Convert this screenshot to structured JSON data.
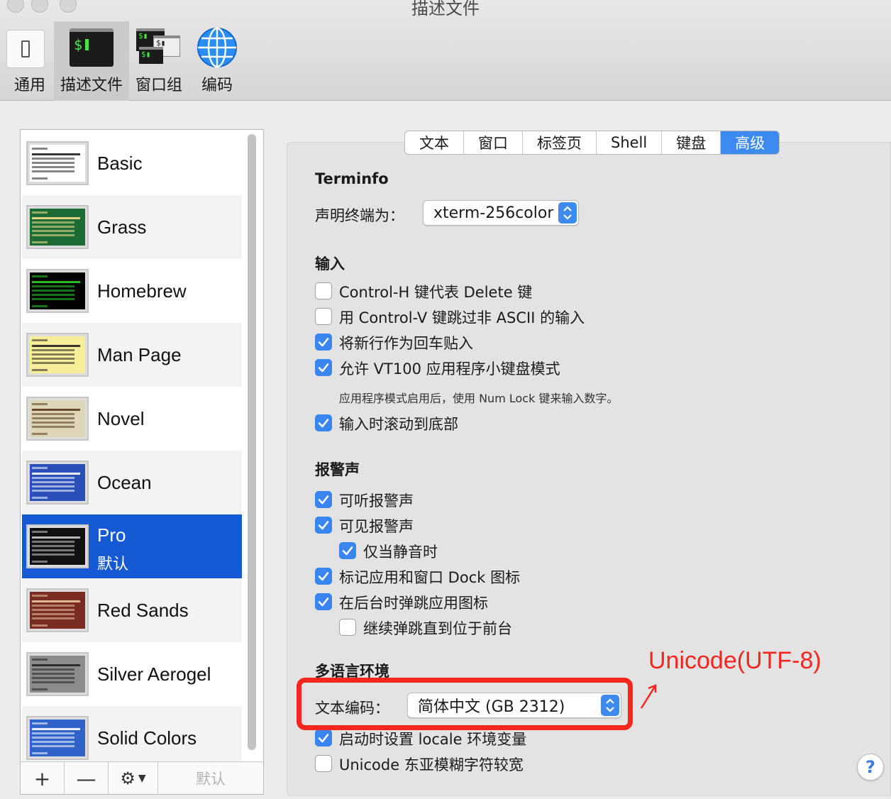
{
  "window": {
    "title": "描述文件"
  },
  "toolbar": {
    "items": [
      {
        "label": "通用"
      },
      {
        "label": "描述文件",
        "selected": true
      },
      {
        "label": "窗口组"
      },
      {
        "label": "编码"
      }
    ],
    "terminal_prompt": "$",
    "terminal_prompt_small": "$"
  },
  "profiles": {
    "items": [
      {
        "name": "Basic",
        "bg": "#ffffff",
        "fg": "#222222"
      },
      {
        "name": "Grass",
        "bg": "#1d6b34",
        "fg": "#f5e08a"
      },
      {
        "name": "Homebrew",
        "bg": "#000000",
        "fg": "#28d12a"
      },
      {
        "name": "Man Page",
        "bg": "#f8ee9a",
        "fg": "#222222"
      },
      {
        "name": "Novel",
        "bg": "#ddd6b9",
        "fg": "#5a3b21"
      },
      {
        "name": "Ocean",
        "bg": "#2a4fb8",
        "fg": "#ffffff"
      },
      {
        "name": "Pro",
        "sub": "默认",
        "bg": "#111111",
        "fg": "#cccccc",
        "selected": true
      },
      {
        "name": "Red Sands",
        "bg": "#7a2c22",
        "fg": "#e8c9a0"
      },
      {
        "name": "Silver Aerogel",
        "bg": "#8c8c8c",
        "fg": "#222222"
      },
      {
        "name": "Solid Colors",
        "bg": "#2f63c9",
        "fg": "#ffffff"
      }
    ],
    "buttons": {
      "add": "+",
      "remove": "—",
      "default": "默认"
    }
  },
  "tabs": [
    {
      "label": "文本"
    },
    {
      "label": "窗口"
    },
    {
      "label": "标签页"
    },
    {
      "label": "Shell"
    },
    {
      "label": "键盘"
    },
    {
      "label": "高级",
      "active": true
    }
  ],
  "terminfo": {
    "heading": "Terminfo",
    "declare_label": "声明终端为：",
    "declare_value": "xterm-256color"
  },
  "input": {
    "heading": "输入",
    "options": [
      {
        "label": "Control-H 键代表 Delete 键",
        "checked": false
      },
      {
        "label": "用 Control-V 键跳过非 ASCII 的输入",
        "checked": false
      },
      {
        "label": "将新行作为回车贴入",
        "checked": true
      },
      {
        "label": "允许 VT100 应用程序小键盘模式",
        "checked": true
      },
      {
        "label": "输入时滚动到底部",
        "checked": true
      }
    ],
    "note": "应用程序模式启用后，使用 Num Lock 键来输入数字。"
  },
  "bell": {
    "heading": "报警声",
    "options": [
      {
        "label": "可听报警声",
        "checked": true
      },
      {
        "label": "可见报警声",
        "checked": true
      },
      {
        "label": "仅当静音时",
        "checked": true
      },
      {
        "label": "标记应用和窗口 Dock 图标",
        "checked": true
      },
      {
        "label": "在后台时弹跳应用图标",
        "checked": true
      },
      {
        "label": "继续弹跳直到位于前台",
        "checked": false
      }
    ]
  },
  "locale": {
    "heading": "多语言环境",
    "encoding_label": "文本编码：",
    "encoding_value": "简体中文 (GB 2312)",
    "options": [
      {
        "label": "启动时设置 locale 环境变量",
        "checked": true
      },
      {
        "label": "Unicode 东亚模糊字符较宽",
        "checked": false
      }
    ]
  },
  "annotation": {
    "text": "Unicode(UTF-8)",
    "color": "#f4271f"
  },
  "help": {
    "label": "?"
  },
  "colors": {
    "accent": "#3d8bf0",
    "selection": "#1559d4"
  }
}
